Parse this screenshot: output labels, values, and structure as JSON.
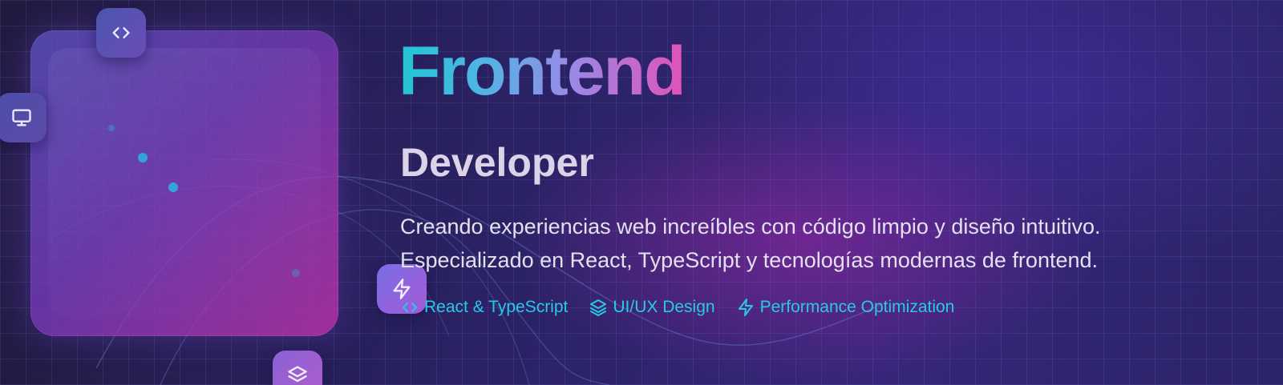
{
  "hero": {
    "title": "Frontend",
    "subtitle": "Developer",
    "description": [
      "Creando experiencias web increíbles con código limpio y diseño intuitivo.",
      "Especializado en React, TypeScript y tecnologías modernas de frontend."
    ]
  },
  "skills": [
    {
      "icon": "code-icon",
      "label": "React & TypeScript"
    },
    {
      "icon": "layers-icon",
      "label": "UI/UX Design"
    },
    {
      "icon": "zap-icon",
      "label": "Performance Optimization"
    }
  ],
  "floating_icons": [
    "code-icon",
    "monitor-icon",
    "zap-icon",
    "layers-icon"
  ],
  "colors": {
    "title_gradient": [
      "#1fc7d4",
      "#9a8ae6",
      "#e052b8"
    ],
    "skill_text": "#2ac8e6",
    "background": "#2a2264"
  }
}
